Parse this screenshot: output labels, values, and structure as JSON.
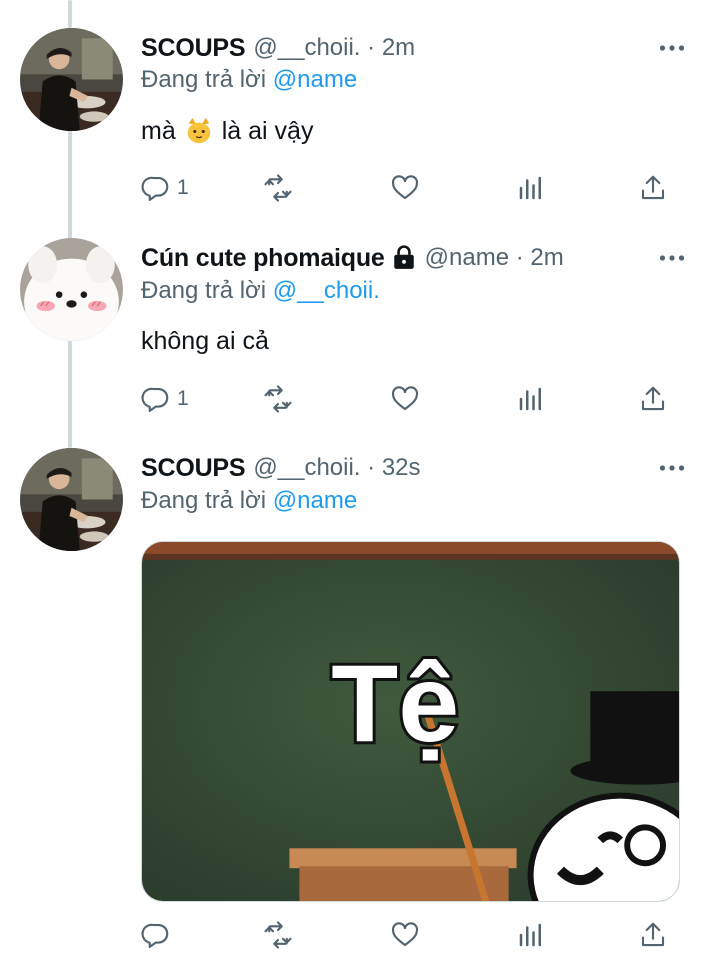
{
  "tweets": [
    {
      "name": "SCOUPS",
      "handle": "@__choii.",
      "time": "· 2m",
      "replying_prefix": "Đang trả lời",
      "replying_to": "@name",
      "text_before": "mà",
      "text_emoji": "cat-face-emoji",
      "text_after": "là ai vậy",
      "reply_count": "1",
      "locked": false
    },
    {
      "name": "Cún cute phomaique",
      "handle": "@name",
      "time": "· 2m",
      "replying_prefix": "Đang trả lời",
      "replying_to": "@__choii.",
      "text": "không ai cả",
      "reply_count": "1",
      "locked": true
    },
    {
      "name": "SCOUPS",
      "handle": "@__choii.",
      "time": "· 32s",
      "replying_prefix": "Đang trả lời",
      "replying_to": "@name",
      "media_caption": "Tệ",
      "reply_count": "",
      "locked": false
    }
  ],
  "icons": {
    "reply": "reply-icon",
    "retweet": "retweet-icon",
    "like": "heart-icon",
    "views": "analytics-icon",
    "share": "share-icon",
    "more": "more-icon",
    "lock": "lock-icon"
  },
  "colors": {
    "text": "#0f1419",
    "secondary": "#536471",
    "accent": "#1d9bf0",
    "thread_line": "#cfd9de"
  }
}
